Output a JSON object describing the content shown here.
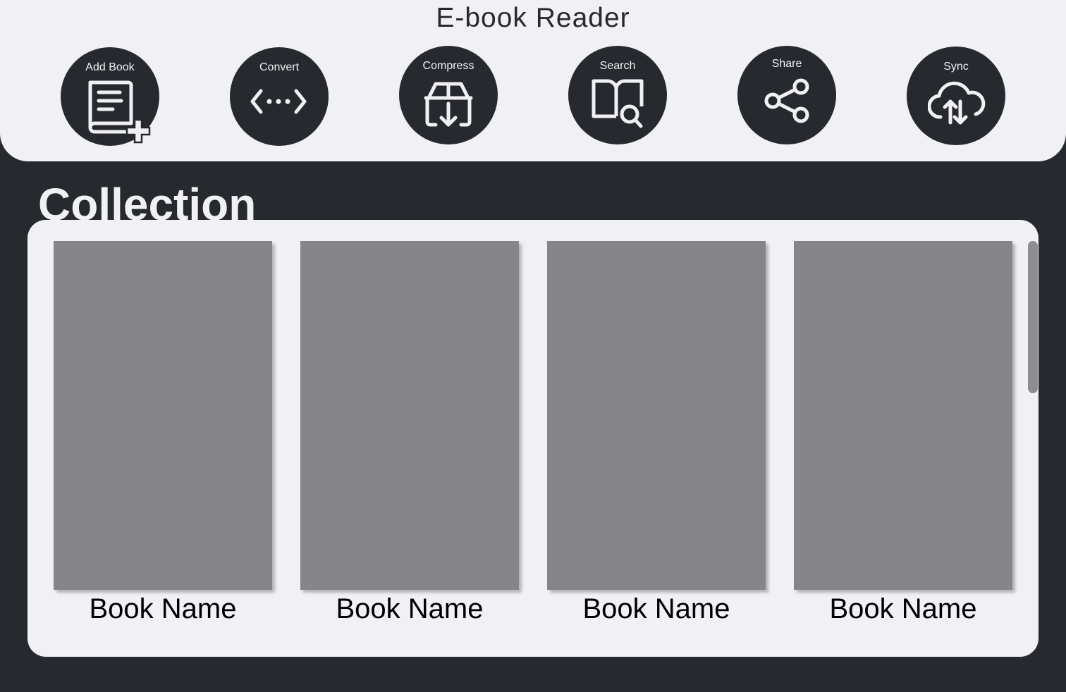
{
  "header": {
    "title": "E-book Reader"
  },
  "toolbar": {
    "add_book": "Add Book",
    "convert": "Convert",
    "compress": "Compress",
    "search": "Search",
    "share": "Share",
    "sync": "Sync"
  },
  "collection": {
    "title": "Collection",
    "books": [
      {
        "name": "Book Name"
      },
      {
        "name": "Book Name"
      },
      {
        "name": "Book Name"
      },
      {
        "name": "Book Name"
      }
    ]
  },
  "colors": {
    "background": "#26292e",
    "surface": "#f1f0f5",
    "cover": "#868688"
  },
  "icons": [
    "add-book-icon",
    "convert-icon",
    "compress-icon",
    "search-book-icon",
    "share-icon",
    "cloud-sync-icon"
  ]
}
